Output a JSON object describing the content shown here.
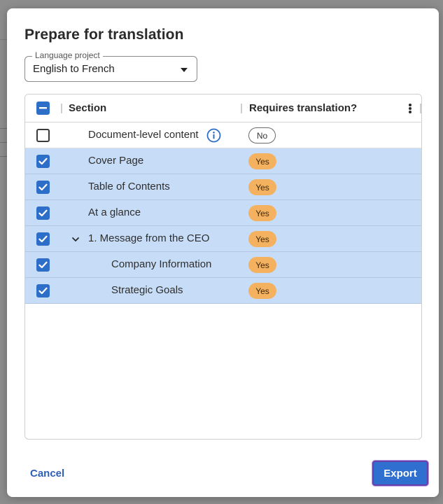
{
  "dialog": {
    "title": "Prepare for translation"
  },
  "language_project": {
    "label": "Language project",
    "value": "English to French"
  },
  "table": {
    "columns": {
      "section": "Section",
      "requires": "Requires translation?"
    },
    "rows": [
      {
        "label": "Document-level content",
        "checked": false,
        "requires": "No",
        "info": true,
        "indent": 0
      },
      {
        "label": "Cover Page",
        "checked": true,
        "requires": "Yes",
        "indent": 0
      },
      {
        "label": "Table of Contents",
        "checked": true,
        "requires": "Yes",
        "indent": 0
      },
      {
        "label": "At a glance",
        "checked": true,
        "requires": "Yes",
        "indent": 0
      },
      {
        "label": "1. Message from the CEO",
        "checked": true,
        "requires": "Yes",
        "expandable": true,
        "indent": 0
      },
      {
        "label": "Company Information",
        "checked": true,
        "requires": "Yes",
        "indent": 1
      },
      {
        "label": "Strategic Goals",
        "checked": true,
        "requires": "Yes",
        "indent": 1
      }
    ]
  },
  "footer": {
    "cancel_label": "Cancel",
    "export_label": "Export"
  },
  "colors": {
    "accent": "#2f6fd0",
    "row_selected": "#c7ddf7",
    "badge_yes": "#f4b160",
    "link": "#2d5fb8"
  },
  "icons": {
    "select_all": "minus-checkbox-icon",
    "info": "info-circle-icon",
    "expand": "chevron-down-icon",
    "menu": "kebab-menu-icon",
    "dropdown": "caret-down-icon"
  }
}
